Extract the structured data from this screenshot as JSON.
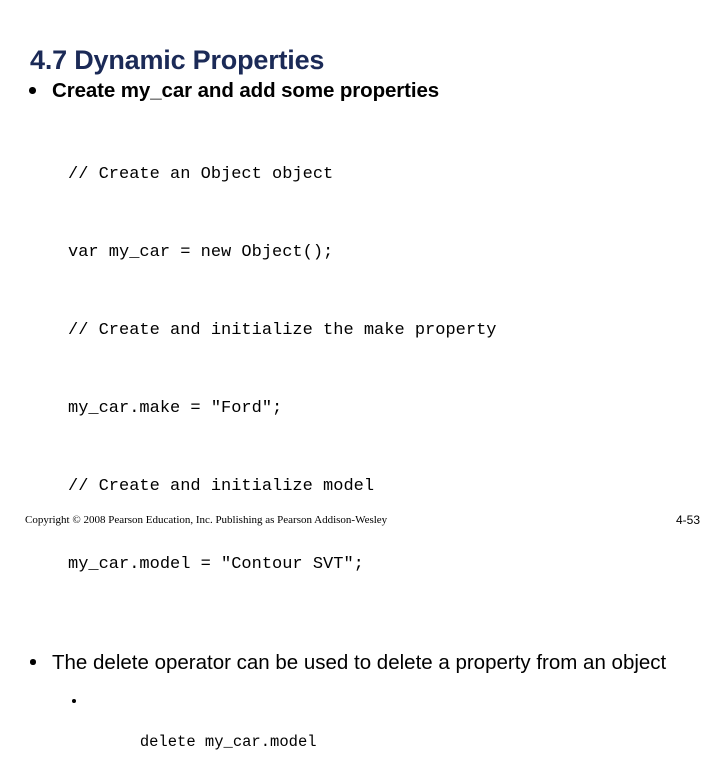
{
  "slide": {
    "title": "4.7 Dynamic Properties",
    "title_color": "#1b2a57",
    "background_color": "#ffffff",
    "text_color": "#000000"
  },
  "bullets": {
    "first": {
      "text": "Create my_car and add some properties"
    },
    "second": {
      "text": "The delete operator can be used to delete a property from an object"
    }
  },
  "code_block": {
    "lines": [
      "// Create an Object object",
      "var my_car = new Object();",
      "// Create and initialize the make property",
      "my_car.make = \"Ford\";",
      "// Create and initialize model",
      "my_car.model = \"Contour SVT\";"
    ]
  },
  "sub_bullet": {
    "code": "delete my_car.model"
  },
  "footer": {
    "copyright": "Copyright © 2008 Pearson Education, Inc. Publishing as Pearson Addison-Wesley",
    "page_number": "4-53"
  }
}
